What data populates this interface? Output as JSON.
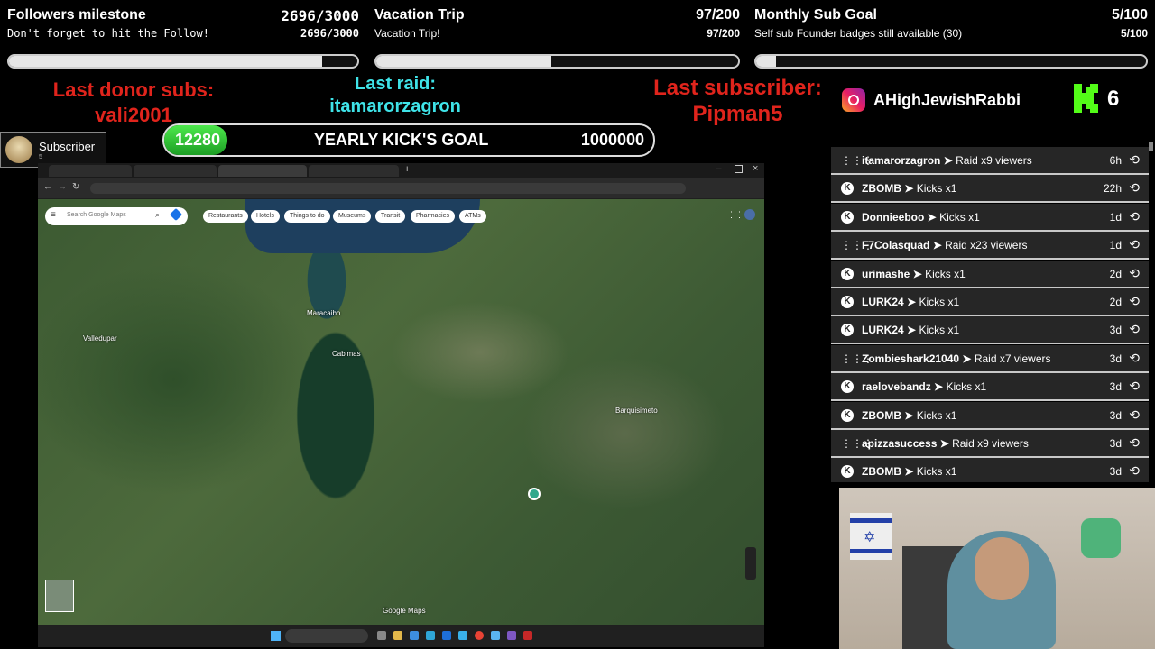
{
  "goals": [
    {
      "title": "Followers milestone",
      "value": "2696/3000",
      "subtitle": "Don't forget to hit the Follow!",
      "subvalue": "2696/3000",
      "progress": 0.899
    },
    {
      "title": "Vacation Trip",
      "value": "97/200",
      "subtitle": "Vacation Trip!",
      "subvalue": "97/200",
      "progress": 0.485
    },
    {
      "title": "Monthly Sub Goal",
      "value": "5/100",
      "subtitle": "Self sub Founder badges still available (30)",
      "subvalue": "5/100",
      "progress": 0.05
    }
  ],
  "labels": {
    "last_donor_title": "Last donor subs:",
    "last_donor_name": "vali2001",
    "last_raid_title": "Last raid:",
    "last_raid_name": "itamarorzagron",
    "last_sub_title": "Last subscriber:",
    "last_sub_name": "Pipman5"
  },
  "kick_goal": {
    "current": "12280",
    "label": "YEARLY KICK'S GOAL",
    "target": "1000000"
  },
  "badge": {
    "label": "Subscriber",
    "sub": "5"
  },
  "social": {
    "instagram": "AHighJewishRabbi",
    "kick_count": "6"
  },
  "map": {
    "search_placeholder": "Search Google Maps",
    "chips": [
      "Restaurants",
      "Hotels",
      "Things to do",
      "Museums",
      "Transit",
      "Pharmacies",
      "ATMs"
    ],
    "places": [
      "Maracaibo",
      "Cabimas",
      "Barquisimeto",
      "Valledupar",
      "Google Maps"
    ]
  },
  "feed": [
    {
      "icon": "raid",
      "user": "itamarorzagron",
      "action": "Raid x9 viewers",
      "time": "6h"
    },
    {
      "icon": "kick",
      "user": "ZBOMB",
      "action": "Kicks x1",
      "time": "22h"
    },
    {
      "icon": "kick",
      "user": "Donnieeboo",
      "action": "Kicks x1",
      "time": "1d"
    },
    {
      "icon": "raid",
      "user": "F7Colasquad",
      "action": "Raid x23 viewers",
      "time": "1d"
    },
    {
      "icon": "kick",
      "user": "urimashe",
      "action": "Kicks x1",
      "time": "2d"
    },
    {
      "icon": "kick",
      "user": "LURK24",
      "action": "Kicks x1",
      "time": "2d"
    },
    {
      "icon": "kick",
      "user": "LURK24",
      "action": "Kicks x1",
      "time": "3d"
    },
    {
      "icon": "raid",
      "user": "Zombieshark21040",
      "action": "Raid x7 viewers",
      "time": "3d"
    },
    {
      "icon": "kick",
      "user": "raelovebandz",
      "action": "Kicks x1",
      "time": "3d"
    },
    {
      "icon": "kick",
      "user": "ZBOMB",
      "action": "Kicks x1",
      "time": "3d"
    },
    {
      "icon": "raid",
      "user": "apizzasuccess",
      "action": "Raid x9 viewers",
      "time": "3d"
    },
    {
      "icon": "kick",
      "user": "ZBOMB",
      "action": "Kicks x1",
      "time": "3d"
    }
  ],
  "colors": {
    "accent_green": "#53fc18",
    "red": "#e0241c",
    "cyan": "#3fe3e8"
  }
}
